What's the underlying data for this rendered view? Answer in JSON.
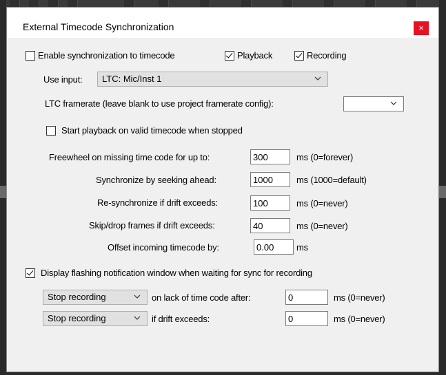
{
  "dialog": {
    "title": "External Timecode Synchronization",
    "close_glyph": "×"
  },
  "sync": {
    "enable_label": "Enable synchronization to timecode",
    "enable_checked": false,
    "playback_label": "Playback",
    "playback_checked": true,
    "recording_label": "Recording",
    "recording_checked": true
  },
  "input": {
    "label": "Use input:",
    "value": "LTC: Mic/Inst 1"
  },
  "framerate": {
    "label": "LTC framerate (leave blank to use project framerate config):",
    "value": ""
  },
  "start_playback": {
    "label": "Start playback on valid timecode when stopped",
    "checked": false
  },
  "fields": {
    "freewheel": {
      "label": "Freewheel on missing time code for up to:",
      "value": "300",
      "hint": "ms (0=forever)"
    },
    "seek": {
      "label": "Synchronize by seeking ahead:",
      "value": "1000",
      "hint": "ms (1000=default)"
    },
    "resync": {
      "label": "Re-synchronize if drift exceeds:",
      "value": "100",
      "hint": "ms (0=never)"
    },
    "skip": {
      "label": "Skip/drop frames if drift exceeds:",
      "value": "40",
      "hint": "ms (0=never)"
    },
    "offset": {
      "label": "Offset incoming timecode by:",
      "value": "0.00",
      "hint": "ms"
    }
  },
  "notify": {
    "label": "Display flashing notification window when waiting for sync for recording",
    "checked": true
  },
  "stop_lack": {
    "action": "Stop recording",
    "label": "on lack of time code after:",
    "value": "0",
    "hint": "ms (0=never)"
  },
  "stop_drift": {
    "action": "Stop recording",
    "label": "if drift exceeds:",
    "value": "0",
    "hint": "ms (0=never)"
  },
  "icons": {
    "checkbox": "checkmark-icon",
    "dropdown": "chevron-down-icon",
    "close": "close-icon"
  },
  "colors": {
    "close_button": "#e81123",
    "dialog_bg": "#f0f0f0",
    "combo_bg": "#e1e1e1"
  }
}
